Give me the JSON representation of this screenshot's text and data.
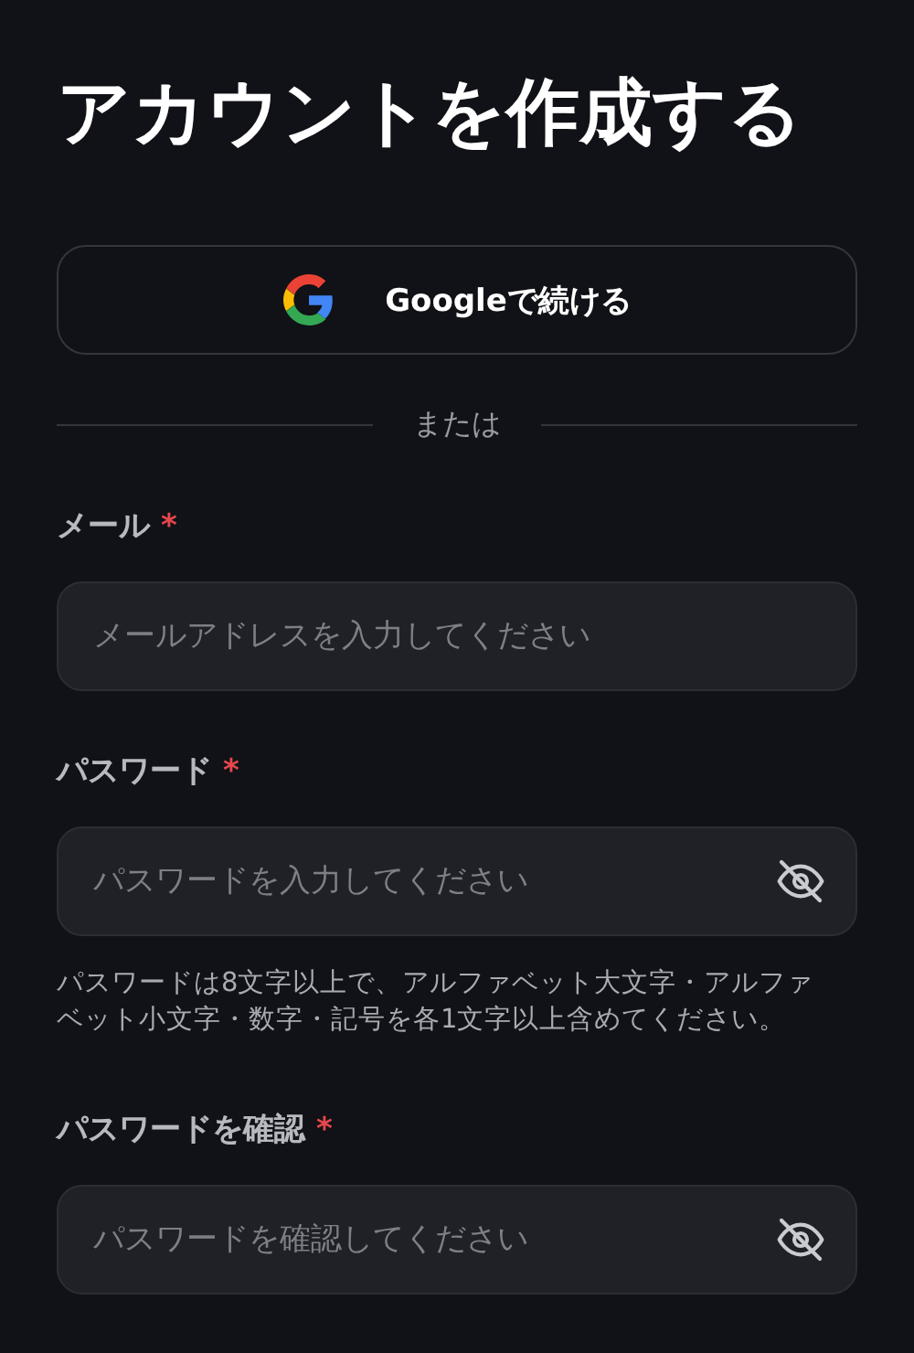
{
  "title": "アカウントを作成する",
  "google_button": {
    "label": "Googleで続ける"
  },
  "divider": {
    "label": "または"
  },
  "fields": [
    {
      "kind": "email",
      "label": "メール",
      "required_mark": "*",
      "placeholder": "メールアドレスを入力してください"
    },
    {
      "kind": "password",
      "label": "パスワード",
      "required_mark": "*",
      "placeholder": "パスワードを入力してください",
      "hint": "パスワードは8文字以上で、アルファベット大文字・アルファベット小文字・数字・記号を各1文字以上含めてください。"
    },
    {
      "kind": "password",
      "label": "パスワードを確認",
      "required_mark": "*",
      "placeholder": "パスワードを確認してください"
    }
  ]
}
